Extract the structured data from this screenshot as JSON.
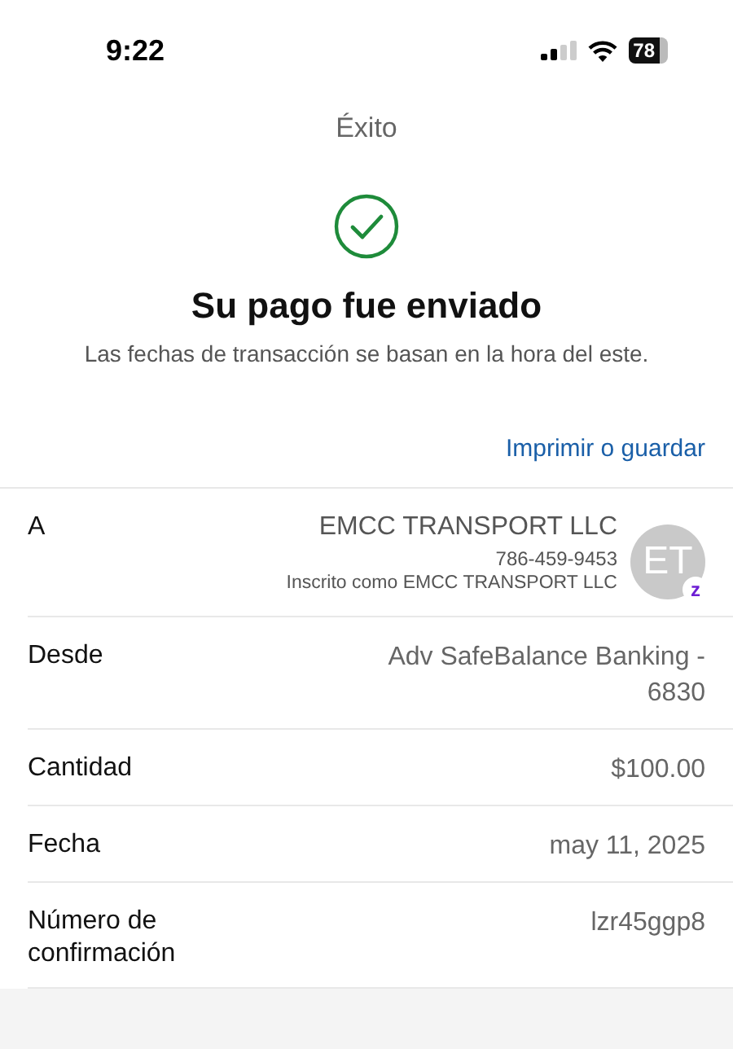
{
  "status_bar": {
    "time": "9:22",
    "battery": "78"
  },
  "title": "Éxito",
  "heading": "Su pago fue enviado",
  "subtitle": "Las fechas de transacción se basan en la hora del este.",
  "print_link": "Imprimir o guardar",
  "details": [
    {
      "kind": "recipient",
      "label": "A",
      "name": "EMCC TRANSPORT LLC",
      "phone": "786-459-9453",
      "note": "Inscrito como EMCC TRANSPORT LLC",
      "initials": "ET",
      "badge": "z"
    },
    {
      "kind": "plain",
      "label": "Desde",
      "value": "Adv SafeBalance Banking - 6830"
    },
    {
      "kind": "plain",
      "label": "Cantidad",
      "value": "$100.00"
    },
    {
      "kind": "plain",
      "label": "Fecha",
      "value": "may 11, 2025"
    },
    {
      "kind": "plain",
      "label": "Número de confirmación",
      "value": "lzr45ggp8"
    }
  ]
}
